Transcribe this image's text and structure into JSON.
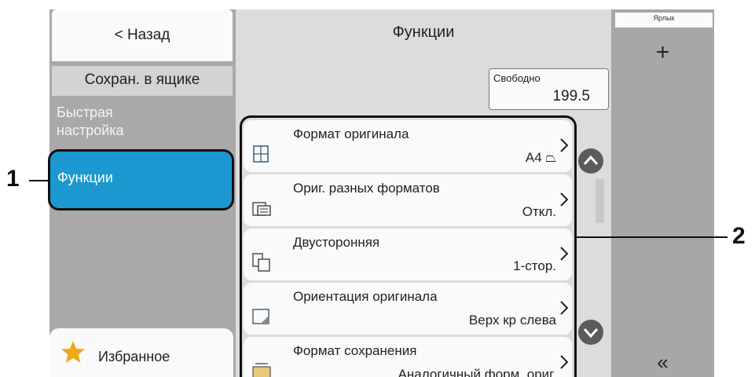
{
  "sidebar": {
    "back_label": "< Назад",
    "save_box_label": "Сохран. в ящике",
    "quick_setup_label": "Быстрая\nнастройка",
    "functions_label": "Функции",
    "favorites_label": "Избранное"
  },
  "main": {
    "title": "Функции",
    "free_label": "Свободно",
    "free_value": "199.5",
    "items": [
      {
        "label": "Формат оригинала",
        "value": "A4 ⏢",
        "icon": "original-size-icon"
      },
      {
        "label": "Ориг. разных форматов",
        "value": "Откл.",
        "icon": "mixed-size-icon"
      },
      {
        "label": "Двусторонняя",
        "value": "1-стор.",
        "icon": "duplex-icon"
      },
      {
        "label": "Ориентация оригинала",
        "value": "Верх кр слева",
        "icon": "orientation-icon"
      },
      {
        "label": "Формат сохранения",
        "value": "Аналогичный форм. ориг.",
        "icon": "storing-size-icon"
      }
    ]
  },
  "right_panel": {
    "shortcut_label": "Ярлык",
    "plus_label": "+",
    "collapse_label": "«"
  },
  "callouts": {
    "one": "1",
    "two": "2"
  },
  "colors": {
    "selected": "#1b98cf",
    "sidebar_bg": "#a9a9a9",
    "main_bg": "#dcdcdc"
  }
}
